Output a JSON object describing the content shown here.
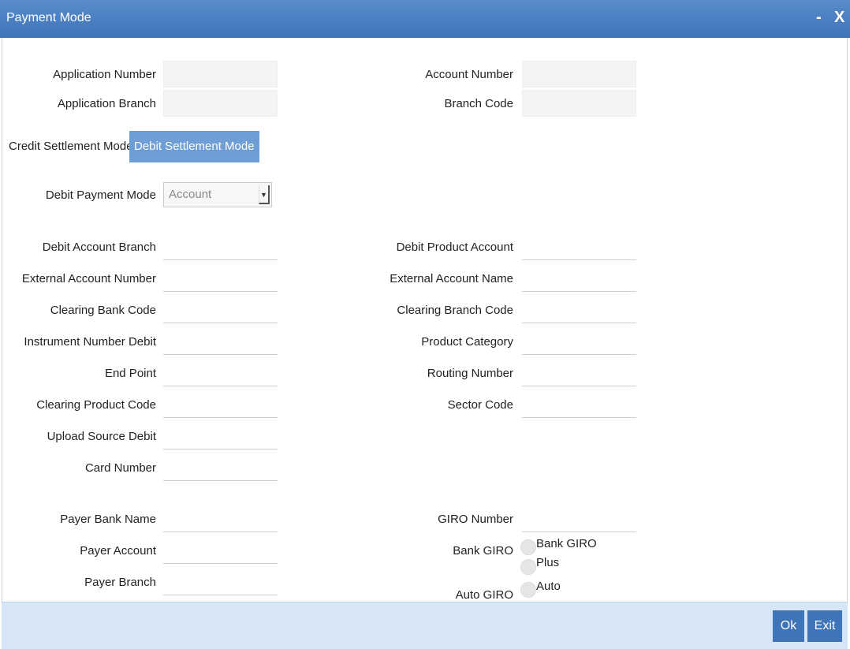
{
  "window": {
    "title": "Payment Mode",
    "minimize_label": "-",
    "close_label": "X"
  },
  "header_fields": {
    "application_number": {
      "label": "Application Number",
      "value": ""
    },
    "application_branch": {
      "label": "Application Branch",
      "value": ""
    },
    "account_number": {
      "label": "Account Number",
      "value": ""
    },
    "branch_code": {
      "label": "Branch Code",
      "value": ""
    }
  },
  "tabs": [
    {
      "label": "Credit Settlement Mode",
      "active": false
    },
    {
      "label": "Debit Settlement Mode",
      "active": true
    }
  ],
  "debit_payment_mode": {
    "label": "Debit Payment Mode",
    "selected": "Account"
  },
  "left_fields": [
    {
      "label": "Debit Account Branch",
      "value": ""
    },
    {
      "label": "External Account Number",
      "value": ""
    },
    {
      "label": "Clearing Bank Code",
      "value": ""
    },
    {
      "label": "Instrument Number Debit",
      "value": ""
    },
    {
      "label": "End Point",
      "value": ""
    },
    {
      "label": "Clearing Product Code",
      "value": ""
    },
    {
      "label": "Upload Source Debit",
      "value": ""
    },
    {
      "label": "Card Number",
      "value": ""
    }
  ],
  "right_fields": [
    {
      "label": "Debit Product Account",
      "value": ""
    },
    {
      "label": "External Account Name",
      "value": ""
    },
    {
      "label": "Clearing Branch Code",
      "value": ""
    },
    {
      "label": "Product Category",
      "value": ""
    },
    {
      "label": "Routing Number",
      "value": ""
    },
    {
      "label": "Sector Code",
      "value": ""
    }
  ],
  "payer_fields": [
    {
      "label": "Payer Bank Name",
      "value": ""
    },
    {
      "label": "Payer Account",
      "value": ""
    },
    {
      "label": "Payer Branch",
      "value": ""
    }
  ],
  "giro": {
    "giro_number": {
      "label": "GIRO Number",
      "value": ""
    },
    "bank_giro": {
      "label": "Bank GIRO",
      "options": [
        "Bank GIRO",
        "Plus"
      ]
    },
    "auto_giro": {
      "label": "Auto GIRO",
      "options": [
        "Auto"
      ]
    }
  },
  "footer": {
    "ok_label": "Ok",
    "exit_label": "Exit"
  }
}
